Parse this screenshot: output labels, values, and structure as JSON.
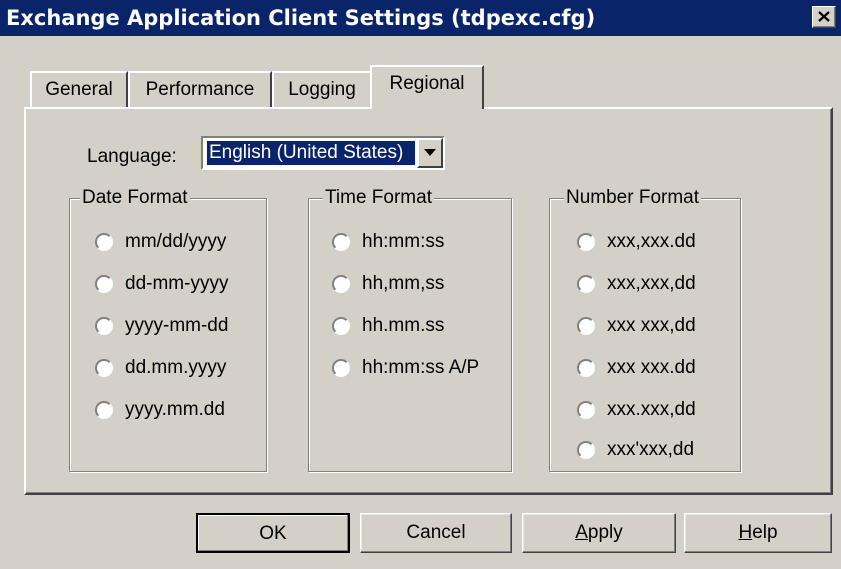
{
  "window": {
    "title": "Exchange Application Client Settings (tdpexc.cfg)"
  },
  "tabs": [
    {
      "label": "General"
    },
    {
      "label": "Performance"
    },
    {
      "label": "Logging"
    },
    {
      "label": "Regional",
      "active": true
    }
  ],
  "language": {
    "label": "Language:",
    "value": "English (United States)"
  },
  "date_format": {
    "title": "Date Format",
    "options": [
      "mm/dd/yyyy",
      "dd-mm-yyyy",
      "yyyy-mm-dd",
      "dd.mm.yyyy",
      "yyyy.mm.dd"
    ]
  },
  "time_format": {
    "title": "Time Format",
    "options": [
      "hh:mm:ss",
      "hh,mm,ss",
      "hh.mm.ss",
      "hh:mm:ss A/P"
    ]
  },
  "number_format": {
    "title": "Number Format",
    "options": [
      "xxx,xxx.dd",
      "xxx,xxx,dd",
      "xxx xxx,dd",
      "xxx xxx.dd",
      "xxx.xxx,dd",
      "xxx'xxx,dd"
    ]
  },
  "buttons": {
    "ok": "OK",
    "cancel": "Cancel",
    "apply_mnemonic": "A",
    "apply_rest": "pply",
    "help_mnemonic": "H",
    "help_rest": "elp"
  },
  "colors": {
    "titlebar": "#0a246a",
    "face": "#d4d0c8",
    "selection": "#0a246a"
  },
  "icons": {
    "close": "close-icon",
    "dropdown": "chevron-down-icon"
  }
}
